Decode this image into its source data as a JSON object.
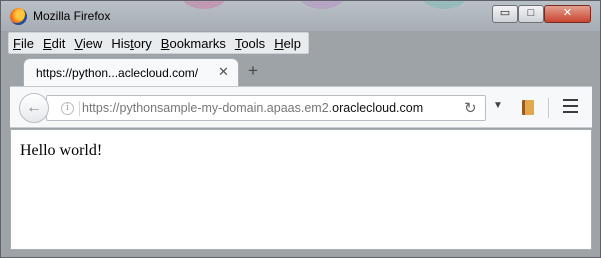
{
  "window": {
    "title": "Mozilla Firefox",
    "controls": {
      "minimize": "▭",
      "maximize": "□",
      "close": "✕"
    }
  },
  "menu": [
    {
      "first": "F",
      "rest": "ile"
    },
    {
      "first": "E",
      "rest": "dit"
    },
    {
      "first": "V",
      "rest": "iew"
    },
    {
      "first": "His",
      "rest": "tory",
      "underline_index": 3
    },
    {
      "first": "B",
      "rest": "ookmarks"
    },
    {
      "first": "T",
      "rest": "ools"
    },
    {
      "first": "H",
      "rest": "elp"
    }
  ],
  "tab": {
    "label": "https://python...aclecloud.com/",
    "close": "✕",
    "new_tab": "+"
  },
  "navbar": {
    "url_prefix": "https://pythonsample-my-domain.apaas.em2.",
    "url_domain": "oraclecloud.com",
    "info_glyph": "i",
    "back_glyph": "←",
    "reload_glyph": "↻",
    "dropdown_glyph": "▼"
  },
  "page": {
    "text": "Hello world!"
  }
}
